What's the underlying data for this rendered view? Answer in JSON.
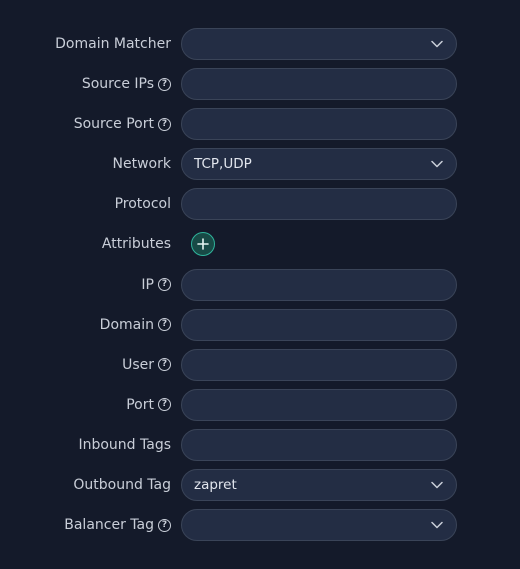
{
  "fields": {
    "domain_matcher": {
      "label": "Domain Matcher",
      "value": ""
    },
    "source_ips": {
      "label": "Source IPs",
      "value": ""
    },
    "source_port": {
      "label": "Source Port",
      "value": ""
    },
    "network": {
      "label": "Network",
      "value": "TCP,UDP"
    },
    "protocol": {
      "label": "Protocol",
      "value": ""
    },
    "attributes": {
      "label": "Attributes"
    },
    "ip": {
      "label": "IP",
      "value": ""
    },
    "domain": {
      "label": "Domain",
      "value": ""
    },
    "user": {
      "label": "User",
      "value": ""
    },
    "port": {
      "label": "Port",
      "value": ""
    },
    "inbound_tags": {
      "label": "Inbound Tags",
      "value": ""
    },
    "outbound_tag": {
      "label": "Outbound Tag",
      "value": "zapret"
    },
    "balancer_tag": {
      "label": "Balancer Tag",
      "value": ""
    }
  },
  "icons": {
    "help": "question-circle-icon",
    "chevron": "chevron-down-icon",
    "add": "plus-icon"
  },
  "colors": {
    "background": "#141a2a",
    "field_bg": "#232d44",
    "field_border": "#3a4458",
    "accent": "#2fb39b"
  }
}
